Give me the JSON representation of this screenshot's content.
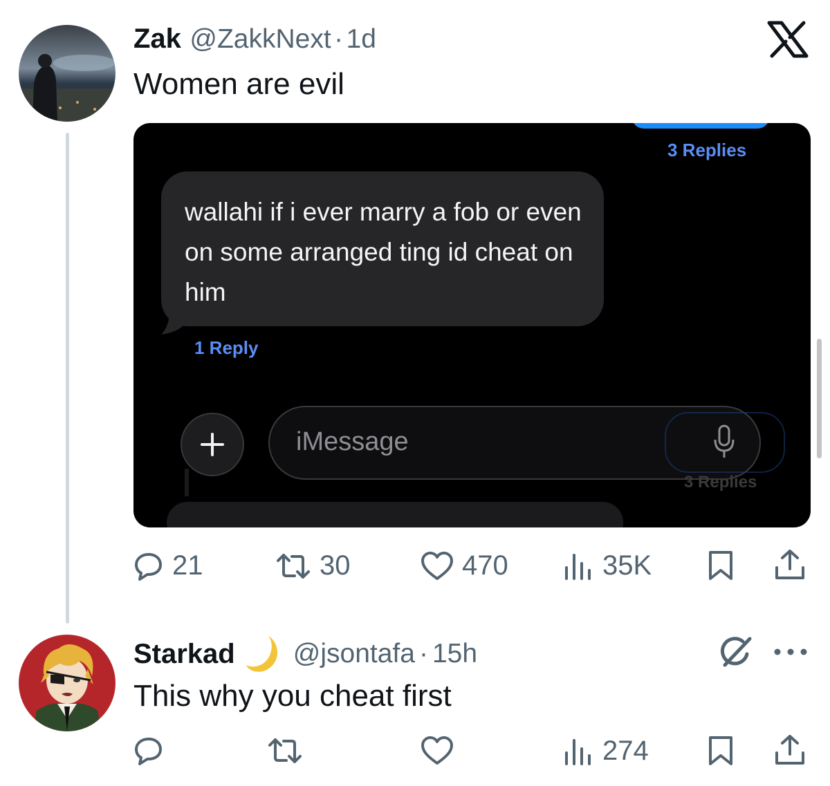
{
  "logo": "X",
  "post": {
    "name": "Zak",
    "handle": "@ZakkNext",
    "separator": "·",
    "time": "1d",
    "text": "Women are evil",
    "media": {
      "top_replies_label": "3 Replies",
      "message_text": "wallahi if i ever marry a fob or even on some arranged ting id cheat on him",
      "reply_label": "1 Reply",
      "input_placeholder": "iMessage",
      "ghost_replies_label": "3 Replies"
    },
    "actions": {
      "replies": "21",
      "reposts": "30",
      "likes": "470",
      "views": "35K"
    }
  },
  "reply": {
    "name": "Starkad",
    "handle": "@jsontafa",
    "separator": "·",
    "time": "15h",
    "text": "This why you cheat first",
    "actions": {
      "views": "274"
    }
  },
  "colors": {
    "text": "#0f1419",
    "muted": "#536471",
    "imessage_blue": "#1d8cf8",
    "reply_link": "#5b8ef5",
    "bubble_gray": "#262628"
  }
}
